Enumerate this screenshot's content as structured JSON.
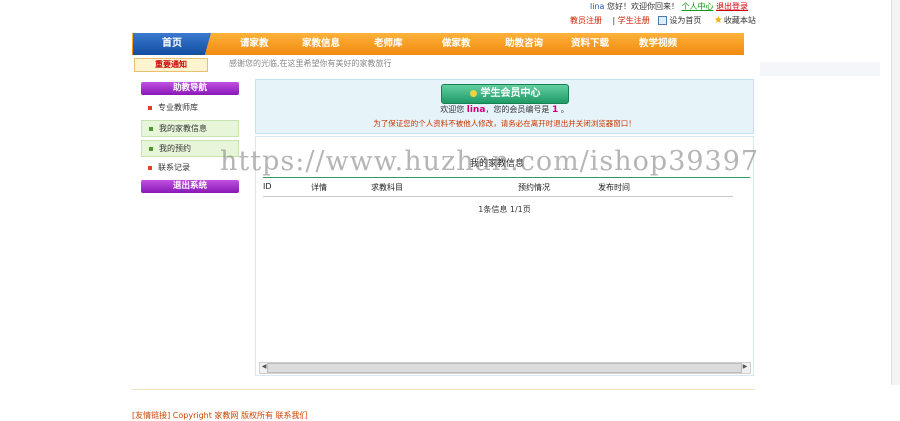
{
  "topbar": {
    "username": "lina",
    "greeting": "您好！欢迎你回来！",
    "member_center": "个人中心",
    "logout": "退出登录",
    "teacher_register": "教员注册",
    "separator": "|",
    "student_register": "学生注册",
    "set_home": "设为首页",
    "bookmark": "收藏本站"
  },
  "nav": {
    "home": "首页",
    "items": [
      "请家教",
      "家教信息",
      "老师库",
      "做家教",
      "助教咨询",
      "资料下载",
      "教学视频"
    ]
  },
  "notice": {
    "tag": "重要通知",
    "text": "感谢您的光临,在这里希望你有美好的家教旅行"
  },
  "sidebar": {
    "header": "助教导航",
    "items": [
      "专业教师库",
      "我的家教信息",
      "我的预约",
      "联系记录"
    ],
    "logout": "退出系统"
  },
  "member_panel": {
    "button": "学生会员中心",
    "welcome_prefix": "欢迎您",
    "name": "lina",
    "welcome_mid": "，您的会员编号是",
    "member_no": "1",
    "welcome_suffix": "。",
    "warning": "为了保证您的个人资料不被他人修改，请务必在离开时退出并关闭浏览器窗口！"
  },
  "content": {
    "title": "我的家教信息",
    "columns": [
      "ID",
      "详情",
      "求教科目",
      "预约情况",
      "发布时间"
    ],
    "pager": "1条信息 1/1页"
  },
  "footer": {
    "text": "[友情链接] Copyright 家教网 版权所有 联系我们"
  },
  "watermark": "https://www.huzhan.com/ishop39397",
  "colors": {
    "nav_orange": "#f39a1e",
    "home_blue": "#1f5fb8",
    "side_purple": "#a32fcf",
    "panel_bg": "#e6f4fa",
    "button_green": "#2fb07a",
    "accent_pink": "#d0007a"
  }
}
